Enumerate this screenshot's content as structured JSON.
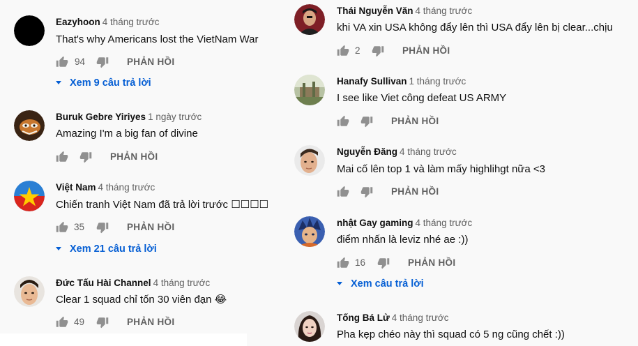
{
  "left_comments": [
    {
      "author": "Eazyhoon",
      "time": "4 tháng trước",
      "text": "That's why Americans lost the VietNam War",
      "likes": "94",
      "reply_label": "PHẢN HỒI",
      "view_replies": "Xem 9 câu trả lời"
    },
    {
      "author": "Buruk Gebre Yiriyes",
      "time": "1 ngày trước",
      "text": "Amazing I'm a big fan of divine",
      "likes": "",
      "reply_label": "PHẢN HỒI"
    },
    {
      "author": "Việt Nam",
      "time": "4 tháng trước",
      "text": "Chiến tranh Việt Nam đã trả lời trước ☐☐☐☐",
      "likes": "35",
      "reply_label": "PHẢN HỒI",
      "view_replies": "Xem 21 câu trả lời"
    },
    {
      "author": "Đức Tấu Hài Channel",
      "time": "4 tháng trước",
      "text": "Clear 1 squad chỉ tốn 30 viên đạn 😂",
      "likes": "49",
      "reply_label": "PHẢN HỒI"
    }
  ],
  "right_comments": [
    {
      "author": "Thái Nguyễn Văn",
      "time": "4 tháng trước",
      "text": "khi VA xin USA không đẩy lên thì USA đẩy lên bị clear...chịu",
      "likes": "2",
      "reply_label": "PHẢN HỒI"
    },
    {
      "author": "Hanafy Sullivan",
      "time": "1 tháng trước",
      "text": "I see like Viet công defeat US ARMY",
      "likes": "",
      "reply_label": "PHẢN HỒI"
    },
    {
      "author": "Nguyễn Đăng",
      "time": "4 tháng trước",
      "text": "Mai cố lên top 1 và làm mấy highlihgt nữa <3",
      "likes": "",
      "reply_label": "PHẢN HỒI"
    },
    {
      "author": "nhật Gay gaming",
      "time": "4 tháng trước",
      "text": "điểm nhấn là leviz nhé ae :))",
      "likes": "16",
      "reply_label": "PHẢN HỒI",
      "view_replies": "Xem câu trả lời"
    },
    {
      "author": "Tống Bá Lử",
      "time": "4 tháng trước",
      "text": "Pha kẹp chéo này thì squad có 5 ng cũng chết :))"
    }
  ],
  "colors": {
    "background": "#f9f9f9",
    "text": "#0f0f0f",
    "secondary_text": "#606060",
    "link_blue": "#065fd4",
    "flag_red": "#da251d",
    "flag_star": "#ffcd00"
  },
  "icons": [
    "thumb-up-icon",
    "thumb-down-icon",
    "caret-down-icon"
  ]
}
